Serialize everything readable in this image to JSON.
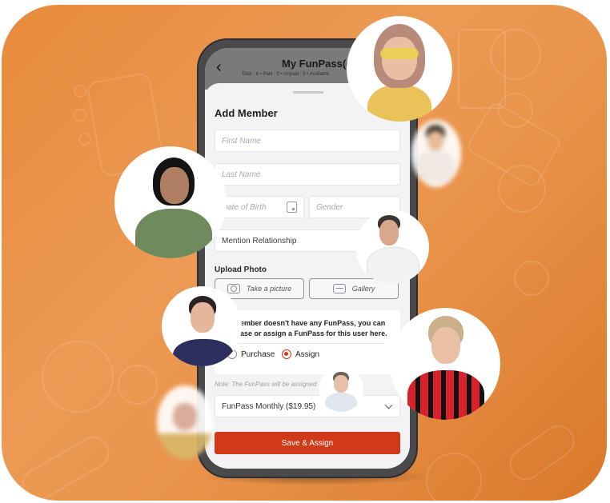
{
  "app": {
    "title": "My FunPass(es)",
    "stats": "Total : 6 • Paid : 0 • Unpaid : 5 • Available",
    "back_icon": "chevron-left-icon"
  },
  "sheet": {
    "title": "Add Member",
    "fields": {
      "first_name": {
        "placeholder": "First Name",
        "value": ""
      },
      "last_name": {
        "placeholder": "Last Name",
        "value": ""
      },
      "dob": {
        "placeholder": "Date of Birth",
        "value": "",
        "icon": "calendar-icon"
      },
      "gender": {
        "placeholder": "Gender",
        "value": ""
      },
      "relationship": {
        "value": "Mention Relationship"
      }
    },
    "upload": {
      "label": "Upload Photo",
      "take_picture": "Take a picture",
      "gallery": "Gallery"
    },
    "notice": {
      "text": "If member doesn't have any FunPass, you can purchase or assign a FunPass for this user here.",
      "visible_text": "ember doesn't have any FunPass, you can ase or assign a FunPass for this user here.",
      "options": [
        {
          "label": "Purchase",
          "selected": false
        },
        {
          "label": "Assign",
          "selected": true
        }
      ]
    },
    "note": "Note: The FunPass will be assigned",
    "plan_select": {
      "value": "FunPass Monthly ($19.95)"
    },
    "submit": "Save & Assign"
  },
  "colors": {
    "brand_orange": "#e78a3a",
    "primary_red": "#d03a18",
    "radio_active": "#d63a1e"
  }
}
